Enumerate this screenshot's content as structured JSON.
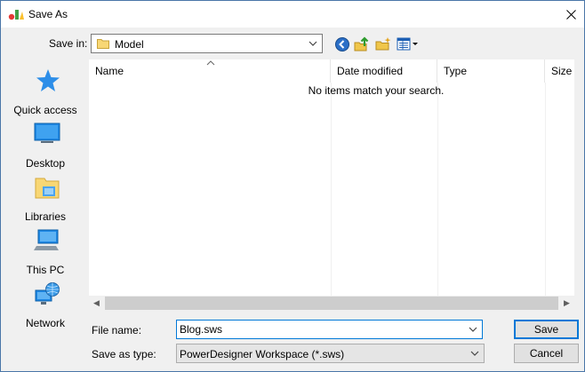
{
  "window": {
    "title": "Save As"
  },
  "savein": {
    "label": "Save in:",
    "value": "Model"
  },
  "places": [
    {
      "label": "Quick access",
      "icon": "quick-access-icon"
    },
    {
      "label": "Desktop",
      "icon": "desktop-icon"
    },
    {
      "label": "Libraries",
      "icon": "libraries-icon"
    },
    {
      "label": "This PC",
      "icon": "this-pc-icon"
    },
    {
      "label": "Network",
      "icon": "network-icon"
    }
  ],
  "filelist": {
    "columns": [
      "Name",
      "Date modified",
      "Type",
      "Size"
    ],
    "empty_message": "No items match your search."
  },
  "filename": {
    "label": "File name:",
    "value": "Blog.sws"
  },
  "filetype": {
    "label": "Save as type:",
    "value": "PowerDesigner Workspace (*.sws)"
  },
  "buttons": {
    "save": "Save",
    "cancel": "Cancel"
  },
  "colors": {
    "accent": "#0078d7",
    "folder": "#f8d775"
  }
}
